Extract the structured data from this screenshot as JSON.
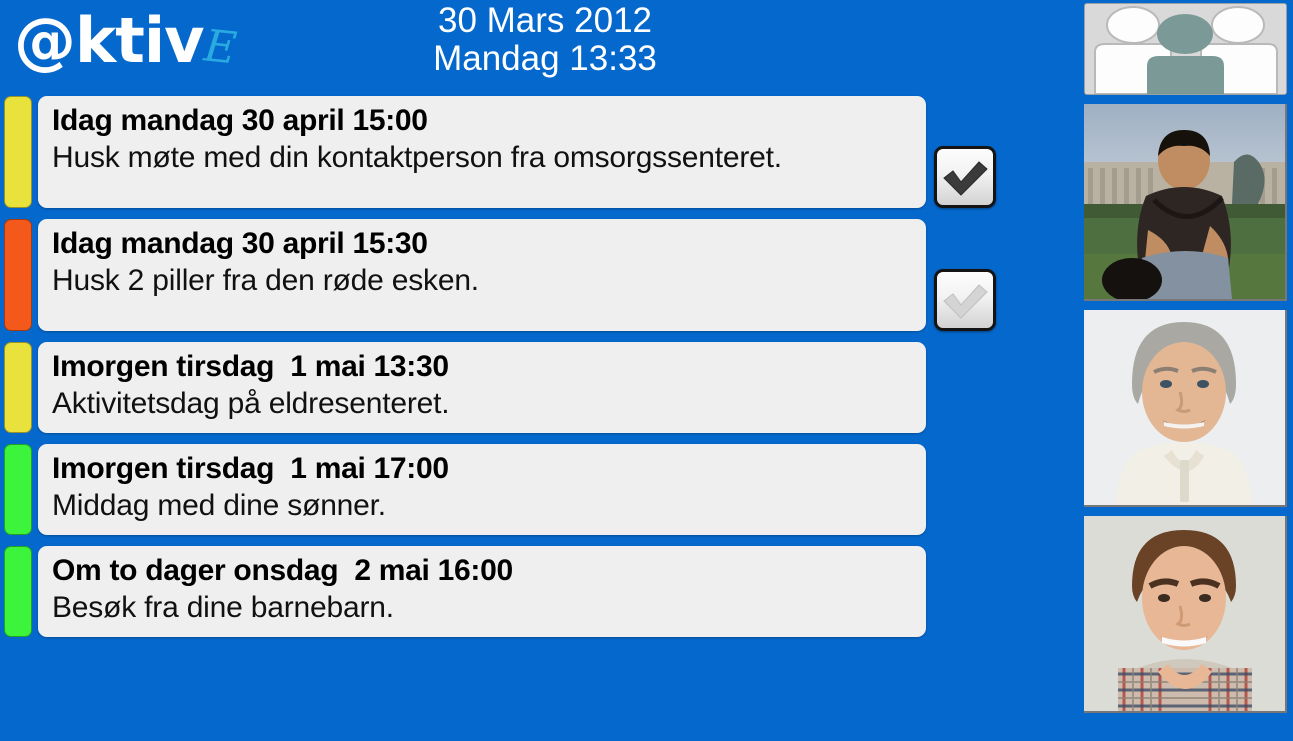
{
  "app": {
    "background_color": "#0568cc",
    "logo_main": "@ktiv",
    "logo_accent": "E",
    "logo_accent_color": "#29abe2"
  },
  "header": {
    "date": "30 Mars 2012",
    "time": "Mandag 13:33"
  },
  "reminders": [
    {
      "title": "Idag mandag 30 april 15:00",
      "body": "Husk møte med din kontaktperson fra omsorgssenteret.",
      "color": "#e9e23c",
      "priority": "yellow",
      "has_checkbox": true,
      "checked": true
    },
    {
      "title": "Idag mandag 30 april 15:30",
      "body": "Husk 2 piller fra den røde esken.",
      "color": "#f4591c",
      "priority": "orange",
      "has_checkbox": true,
      "checked": false
    },
    {
      "title": "Imorgen tirsdag  1 mai 13:30",
      "body": "Aktivitetsdag på eldresenteret.",
      "color": "#e9e23c",
      "priority": "yellow",
      "has_checkbox": false,
      "checked": false
    },
    {
      "title": "Imorgen tirsdag  1 mai 17:00",
      "body": "Middag med dine sønner.",
      "color": "#3cf43c",
      "priority": "green",
      "has_checkbox": false,
      "checked": false
    },
    {
      "title": "Om to dager onsdag  2 mai 16:00",
      "body": "Besøk fra dine barnebarn.",
      "color": "#3cf43c",
      "priority": "green",
      "has_checkbox": false,
      "checked": false
    }
  ],
  "sidebar": {
    "tiles": [
      {
        "kind": "icon",
        "icon": "contacts-group-icon"
      },
      {
        "kind": "photo",
        "icon": "contact-photo-young-man-outdoors"
      },
      {
        "kind": "photo",
        "icon": "contact-photo-grey-haired-man"
      },
      {
        "kind": "photo",
        "icon": "contact-photo-young-man-checked-shirt"
      }
    ]
  }
}
